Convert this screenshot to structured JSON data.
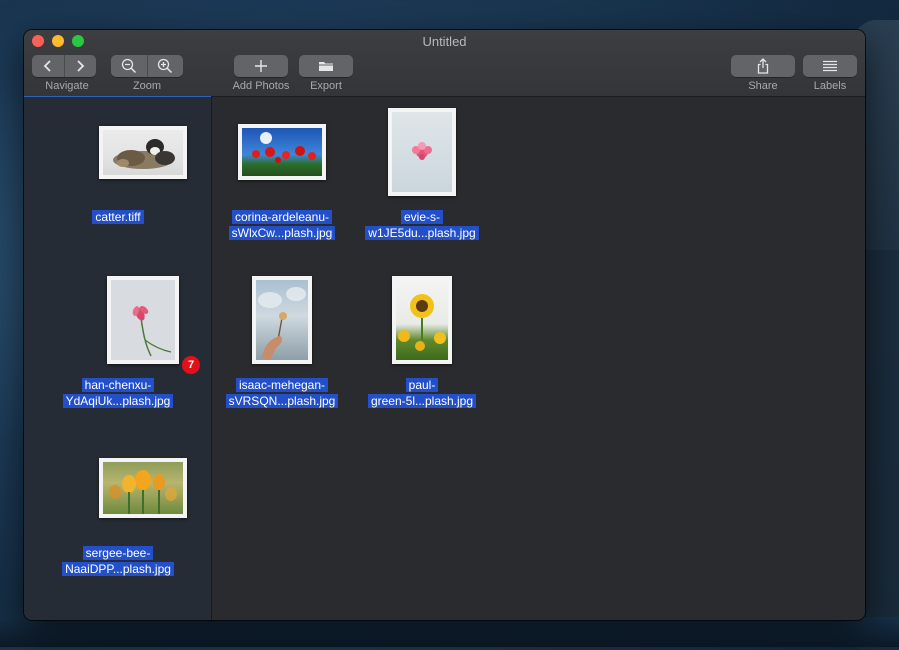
{
  "window": {
    "title": "Untitled"
  },
  "toolbar": {
    "navigate_label": "Navigate",
    "zoom_label": "Zoom",
    "add_photos_label": "Add Photos",
    "export_label": "Export",
    "share_label": "Share",
    "labels_label": "Labels"
  },
  "sidebar": {
    "items": [
      {
        "caption_line1": "catter.tiff",
        "caption_line2": "",
        "image": "cats-photo"
      },
      {
        "caption_line1": "han-chenxu-",
        "caption_line2": "YdAqiUk...plash.jpg",
        "image": "pink-flower-stem-photo",
        "badge": "7"
      },
      {
        "caption_line1": "sergee-bee-",
        "caption_line2": "NaaiDPP...plash.jpg",
        "image": "orange-tulips-photo"
      }
    ]
  },
  "grid": {
    "items": [
      {
        "caption_line1": "corina-ardeleanu-",
        "caption_line2": "sWlxCw...plash.jpg",
        "image": "red-poppies-sky-photo"
      },
      {
        "caption_line1": "evie-s-",
        "caption_line2": "w1JE5du...plash.jpg",
        "image": "pink-flower-sky-photo"
      },
      {
        "caption_line1": "isaac-mehegan-",
        "caption_line2": "sVRSQN...plash.jpg",
        "image": "hand-holding-flower-photo"
      },
      {
        "caption_line1": "paul-",
        "caption_line2": "green-5l...plash.jpg",
        "image": "sunflowers-photo"
      }
    ]
  },
  "colors": {
    "selection": "#2350c9",
    "badge": "#e3101a",
    "sidebar_bg": "#262c35"
  }
}
